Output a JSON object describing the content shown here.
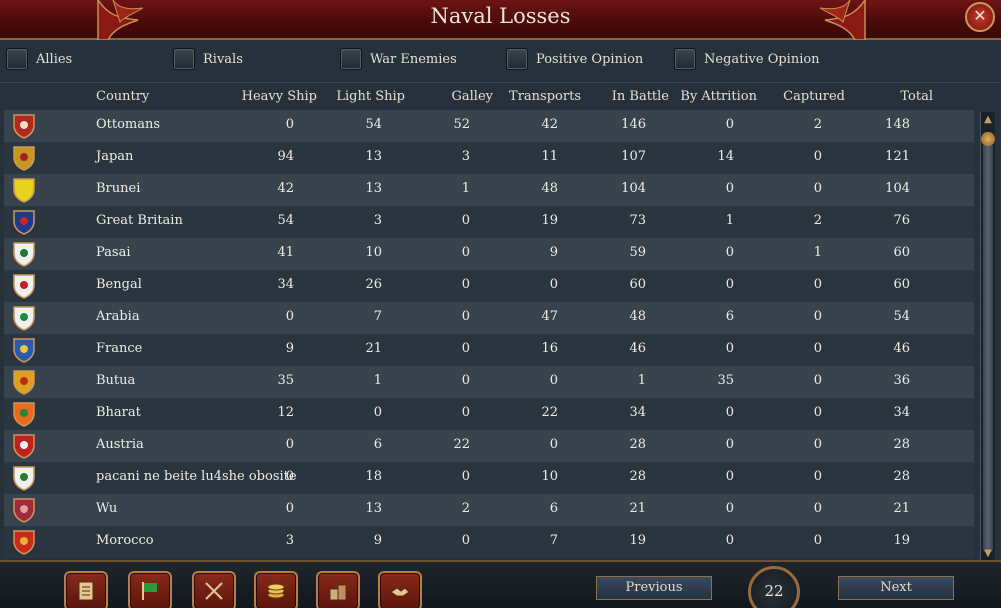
{
  "window": {
    "title": "Naval Losses",
    "close_glyph": "✕"
  },
  "filters": [
    {
      "label": "Allies",
      "checked": false
    },
    {
      "label": "Rivals",
      "checked": false
    },
    {
      "label": "War Enemies",
      "checked": false
    },
    {
      "label": "Positive Opinion",
      "checked": false
    },
    {
      "label": "Negative Opinion",
      "checked": false
    }
  ],
  "columns": [
    "Country",
    "Heavy Ship",
    "Light Ship",
    "Galley",
    "Transports",
    "In Battle",
    "By Attrition",
    "Captured",
    "Total"
  ],
  "rows": [
    {
      "country": "Ottomans",
      "heavy": "0",
      "light": "54",
      "galley": "52",
      "transports": "42",
      "battle": "146",
      "attrition": "0",
      "captured": "2",
      "total": "148",
      "flag_color": "#b3281e",
      "flag_accent": "#f0e0c0"
    },
    {
      "country": "Japan",
      "heavy": "94",
      "light": "13",
      "galley": "3",
      "transports": "11",
      "battle": "107",
      "attrition": "14",
      "captured": "0",
      "total": "121",
      "flag_color": "#c8961e",
      "flag_accent": "#a82020"
    },
    {
      "country": "Brunei",
      "heavy": "42",
      "light": "13",
      "galley": "1",
      "transports": "48",
      "battle": "104",
      "attrition": "0",
      "captured": "0",
      "total": "104",
      "flag_color": "#e8d21e",
      "flag_accent": "#e8d21e"
    },
    {
      "country": "Great Britain",
      "heavy": "54",
      "light": "3",
      "galley": "0",
      "transports": "19",
      "battle": "73",
      "attrition": "1",
      "captured": "2",
      "total": "76",
      "flag_color": "#1e3a8a",
      "flag_accent": "#d02020"
    },
    {
      "country": "Pasai",
      "heavy": "41",
      "light": "10",
      "galley": "0",
      "transports": "9",
      "battle": "59",
      "attrition": "0",
      "captured": "1",
      "total": "60",
      "flag_color": "#f0f0f0",
      "flag_accent": "#1e7a2a"
    },
    {
      "country": "Bengal",
      "heavy": "34",
      "light": "26",
      "galley": "0",
      "transports": "0",
      "battle": "60",
      "attrition": "0",
      "captured": "0",
      "total": "60",
      "flag_color": "#f0f0f0",
      "flag_accent": "#c02020"
    },
    {
      "country": "Arabia",
      "heavy": "0",
      "light": "7",
      "galley": "0",
      "transports": "47",
      "battle": "48",
      "attrition": "6",
      "captured": "0",
      "total": "54",
      "flag_color": "#f0f0f0",
      "flag_accent": "#1e8a3a"
    },
    {
      "country": "France",
      "heavy": "9",
      "light": "21",
      "galley": "0",
      "transports": "16",
      "battle": "46",
      "attrition": "0",
      "captured": "0",
      "total": "46",
      "flag_color": "#2a5ab0",
      "flag_accent": "#e8c83a"
    },
    {
      "country": "Butua",
      "heavy": "35",
      "light": "1",
      "galley": "0",
      "transports": "0",
      "battle": "1",
      "attrition": "35",
      "captured": "0",
      "total": "36",
      "flag_color": "#e0a020",
      "flag_accent": "#c02a1a"
    },
    {
      "country": "Bharat",
      "heavy": "12",
      "light": "0",
      "galley": "0",
      "transports": "22",
      "battle": "34",
      "attrition": "0",
      "captured": "0",
      "total": "34",
      "flag_color": "#e86a1a",
      "flag_accent": "#1e8a3a"
    },
    {
      "country": "Austria",
      "heavy": "0",
      "light": "6",
      "galley": "22",
      "transports": "0",
      "battle": "28",
      "attrition": "0",
      "captured": "0",
      "total": "28",
      "flag_color": "#c02020",
      "flag_accent": "#f0f0f0"
    },
    {
      "country": "pacani ne beite lu4she obosite",
      "heavy": "0",
      "light": "18",
      "galley": "0",
      "transports": "10",
      "battle": "28",
      "attrition": "0",
      "captured": "0",
      "total": "28",
      "flag_color": "#f0f0f0",
      "flag_accent": "#2a7a2a"
    },
    {
      "country": "Wu",
      "heavy": "0",
      "light": "13",
      "galley": "2",
      "transports": "6",
      "battle": "21",
      "attrition": "0",
      "captured": "0",
      "total": "21",
      "flag_color": "#a02a3a",
      "flag_accent": "#e0a0a0"
    },
    {
      "country": "Morocco",
      "heavy": "3",
      "light": "9",
      "galley": "0",
      "transports": "7",
      "battle": "19",
      "attrition": "0",
      "captured": "0",
      "total": "19",
      "flag_color": "#c82a1a",
      "flag_accent": "#e8b030"
    }
  ],
  "bottom": {
    "icons": [
      "ledger-icon",
      "flag-icon",
      "crossed-swords-icon",
      "coins-icon",
      "buildings-icon",
      "handshake-icon"
    ],
    "previous_label": "Previous",
    "next_label": "Next",
    "page": "22"
  },
  "colors": {
    "title_bg": "#5a0e0e",
    "row_odd": "#38434e",
    "row_even": "#2b353f",
    "gold": "#b08048"
  }
}
